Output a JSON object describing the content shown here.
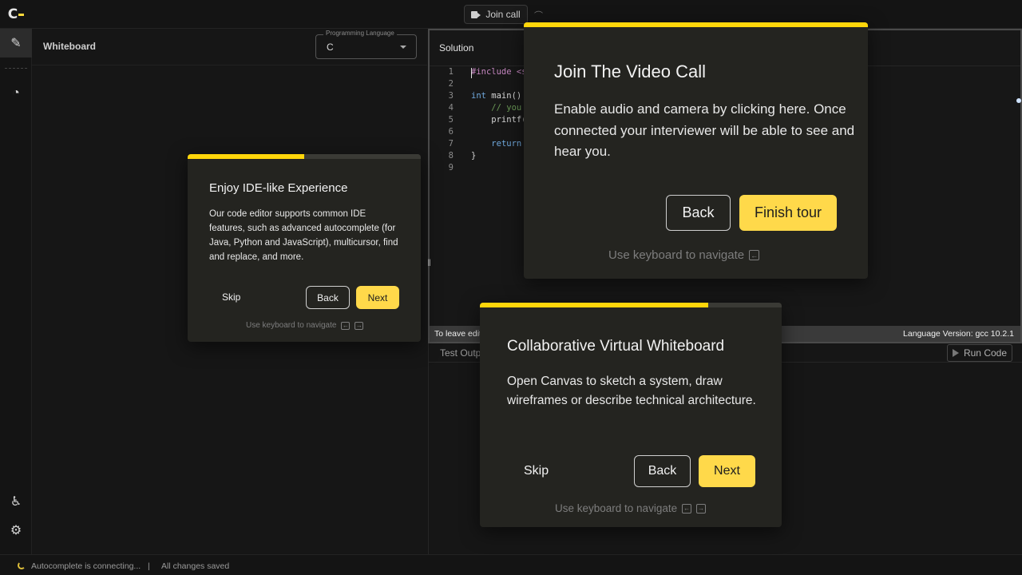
{
  "topbar": {
    "logo_letter": "C",
    "join_call_label": "Join call",
    "signal_glyph": "⌒"
  },
  "rail": {
    "edit_glyph": "✎",
    "palette_glyph": "◔",
    "accessibility_glyph": "♿",
    "settings_glyph": "⚙"
  },
  "whiteboard": {
    "title": "Whiteboard",
    "language_label": "Programming Language",
    "language_value": "C"
  },
  "solution": {
    "title": "Solution",
    "lines": [
      {
        "num": "1",
        "text": "#include <s",
        "kind": "plain"
      },
      {
        "num": "2",
        "text": "",
        "kind": "plain"
      },
      {
        "num": "3",
        "text": "int main()",
        "kind": "plain"
      },
      {
        "num": "4",
        "text": "    // you",
        "kind": "comment"
      },
      {
        "num": "5",
        "text": "    printf(",
        "kind": "plain"
      },
      {
        "num": "6",
        "text": "",
        "kind": "plain"
      },
      {
        "num": "7",
        "text": "    return",
        "kind": "plain"
      },
      {
        "num": "8",
        "text": "}",
        "kind": "plain"
      },
      {
        "num": "9",
        "text": "",
        "kind": "plain"
      }
    ],
    "status_left": "To leave edit",
    "status_right": "Language Version: gcc 10.2.1"
  },
  "test": {
    "label": "Test Outp",
    "run_label": "Run Code"
  },
  "footer": {
    "autocomplete_status": "Autocomplete is connecting...",
    "separator": "|",
    "save_status": "All changes saved"
  },
  "tour_ide": {
    "title": "Enjoy IDE-like Experience",
    "description": "Our code editor supports common IDE features, such as advanced autocomplete (for Java, Python and JavaScript), multicursor, find and replace, and more.",
    "skip_label": "Skip",
    "back_label": "Back",
    "next_label": "Next",
    "keyboard_hint": "Use keyboard to navigate",
    "progress": 0.5
  },
  "tour_video": {
    "title": "Join The Video Call",
    "description": "Enable audio and camera by clicking here. Once connected your interviewer will be able to see and hear you.",
    "back_label": "Back",
    "finish_label": "Finish tour",
    "keyboard_hint": "Use keyboard to navigate",
    "progress": 1.0
  },
  "tour_whiteboard": {
    "title": "Collaborative Virtual Whiteboard",
    "description": "Open Canvas to sketch a system, draw wireframes or describe technical architecture.",
    "skip_label": "Skip",
    "back_label": "Back",
    "next_label": "Next",
    "keyboard_hint": "Use keyboard to navigate",
    "progress": 0.75
  },
  "glyphs": {
    "key_left": "←",
    "key_right": "→"
  },
  "colors": {
    "accent": "#ffd94a",
    "progress": "#ffd60a",
    "card_bg": "#242420"
  }
}
